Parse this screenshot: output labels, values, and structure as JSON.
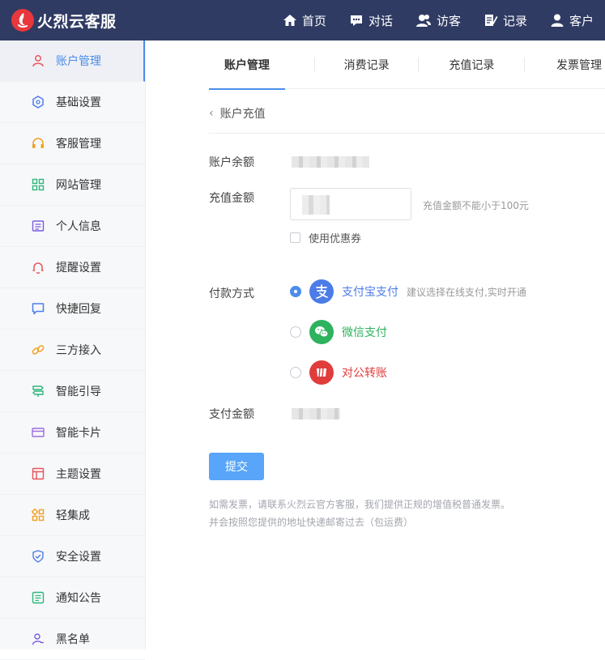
{
  "app": {
    "brand": "火烈云客服"
  },
  "topnav": [
    {
      "label": "首页",
      "icon": "home-icon"
    },
    {
      "label": "对话",
      "icon": "chat-icon"
    },
    {
      "label": "访客",
      "icon": "visitors-icon"
    },
    {
      "label": "记录",
      "icon": "record-icon"
    },
    {
      "label": "客户",
      "icon": "customer-icon"
    }
  ],
  "sidebar": {
    "items": [
      {
        "label": "账户管理",
        "icon": "user-icon",
        "color": "#e8545b",
        "active": true
      },
      {
        "label": "基础设置",
        "icon": "hexagon-icon",
        "color": "#4c7ce8"
      },
      {
        "label": "客服管理",
        "icon": "headset-icon",
        "color": "#f0a020"
      },
      {
        "label": "网站管理",
        "icon": "grid-icon",
        "color": "#2fb67a"
      },
      {
        "label": "个人信息",
        "icon": "profile-card-icon",
        "color": "#7b5ce0"
      },
      {
        "label": "提醒设置",
        "icon": "bell-icon",
        "color": "#e8545b"
      },
      {
        "label": "快捷回复",
        "icon": "message-icon",
        "color": "#4c7ce8"
      },
      {
        "label": "三方接入",
        "icon": "link-icon",
        "color": "#f0a020"
      },
      {
        "label": "智能引导",
        "icon": "signpost-icon",
        "color": "#2fb67a"
      },
      {
        "label": "智能卡片",
        "icon": "card-icon",
        "color": "#9b6ce0"
      },
      {
        "label": "主题设置",
        "icon": "layout-icon",
        "color": "#e8545b"
      },
      {
        "label": "轻集成",
        "icon": "blocks-icon",
        "color": "#f0a020"
      },
      {
        "label": "安全设置",
        "icon": "shield-icon",
        "color": "#4c7ce8"
      },
      {
        "label": "通知公告",
        "icon": "notice-icon",
        "color": "#2fb67a"
      },
      {
        "label": "黑名单",
        "icon": "blacklist-icon",
        "color": "#7b5ce0"
      }
    ]
  },
  "tabs": [
    {
      "label": "账户管理",
      "active": true
    },
    {
      "label": "消费记录"
    },
    {
      "label": "充值记录"
    },
    {
      "label": "发票管理"
    }
  ],
  "breadcrumb": {
    "label": "账户充值"
  },
  "form": {
    "balance_label": "账户余额",
    "amount_label": "充值金额",
    "amount_hint": "充值金额不能小于100元",
    "coupon_label": "使用优惠券",
    "pay_method_label": "付款方式",
    "pay_amount_label": "支付金额",
    "submit_label": "提交"
  },
  "payment_methods": [
    {
      "name": "支付宝支付",
      "note": "建议选择在线支付,实时开通",
      "color": "#4c7ce8",
      "icon": "alipay-icon",
      "selected": true
    },
    {
      "name": "微信支付",
      "note": "",
      "color": "#2db25e",
      "icon": "wechat-icon",
      "selected": false
    },
    {
      "name": "对公转账",
      "note": "",
      "color": "#e03c3c",
      "icon": "bank-transfer-icon",
      "selected": false
    }
  ],
  "notice": {
    "line1": "如需发票，请联系火烈云官方客服，我们提供正规的增值税普通发票。",
    "line2": "并会按照您提供的地址快递邮寄过去（包运费）"
  }
}
